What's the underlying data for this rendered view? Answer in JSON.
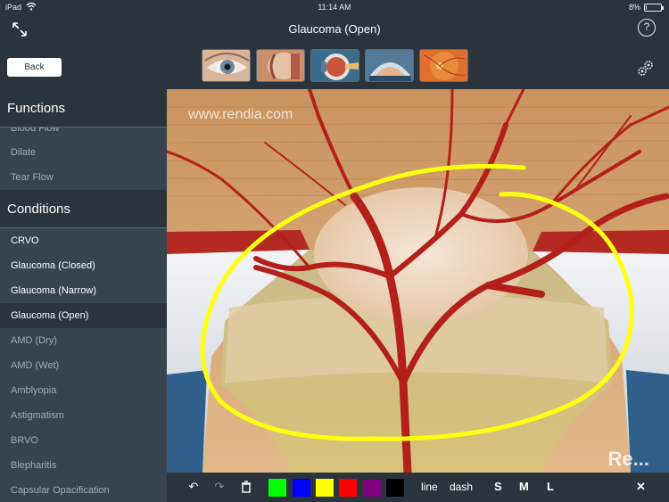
{
  "status_bar": {
    "carrier": "iPad",
    "time": "11:14 AM",
    "battery": "8%",
    "battery_level": 0.08
  },
  "nav": {
    "title": "Glaucoma (Open)",
    "help_label": "?"
  },
  "toolbar": {
    "back_label": "Back",
    "thumbnails": [
      "eye-exterior",
      "eye-cross-section",
      "eyeball-side",
      "eye-anterior",
      "retina"
    ]
  },
  "sidebar": {
    "functions_header": "Functions",
    "functions_items": [
      "Blood Flow",
      "Dilate",
      "Tear Flow"
    ],
    "conditions_header": "Conditions",
    "conditions_items": [
      "CRVO",
      "Glaucoma (Closed)",
      "Glaucoma (Narrow)",
      "Glaucoma (Open)",
      "AMD (Dry)",
      "AMD (Wet)",
      "Amblyopia",
      "Astigmatism",
      "BRVO",
      "Blepharitis",
      "Capsular Opacification"
    ],
    "selected": "Glaucoma (Open)"
  },
  "image": {
    "watermark": "www.rendia.com",
    "corner_mark": "Re..."
  },
  "draw_toolbar": {
    "colors": [
      "#00ff00",
      "#0000ff",
      "#ffff00",
      "#ff0000",
      "#800080",
      "#000000"
    ],
    "line_label": "line",
    "dash_label": "dash",
    "sizes": [
      "S",
      "M",
      "L"
    ],
    "close_label": "✕"
  }
}
